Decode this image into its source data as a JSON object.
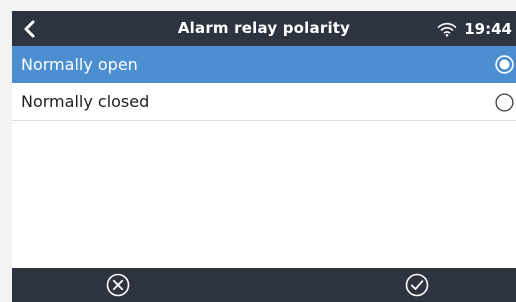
{
  "header": {
    "back_icon": "chevron-left-icon",
    "title": "Alarm relay polarity",
    "wifi_icon": "wifi-icon",
    "time": "19:44"
  },
  "options": [
    {
      "label": "Normally open",
      "selected": true
    },
    {
      "label": "Normally closed",
      "selected": false
    }
  ],
  "footer": {
    "cancel_icon": "circle-x-icon",
    "confirm_icon": "circle-check-icon"
  },
  "colors": {
    "header_bg": "#2d3440",
    "selected_bg": "#4b8fd1",
    "text": "#1b1e22"
  }
}
